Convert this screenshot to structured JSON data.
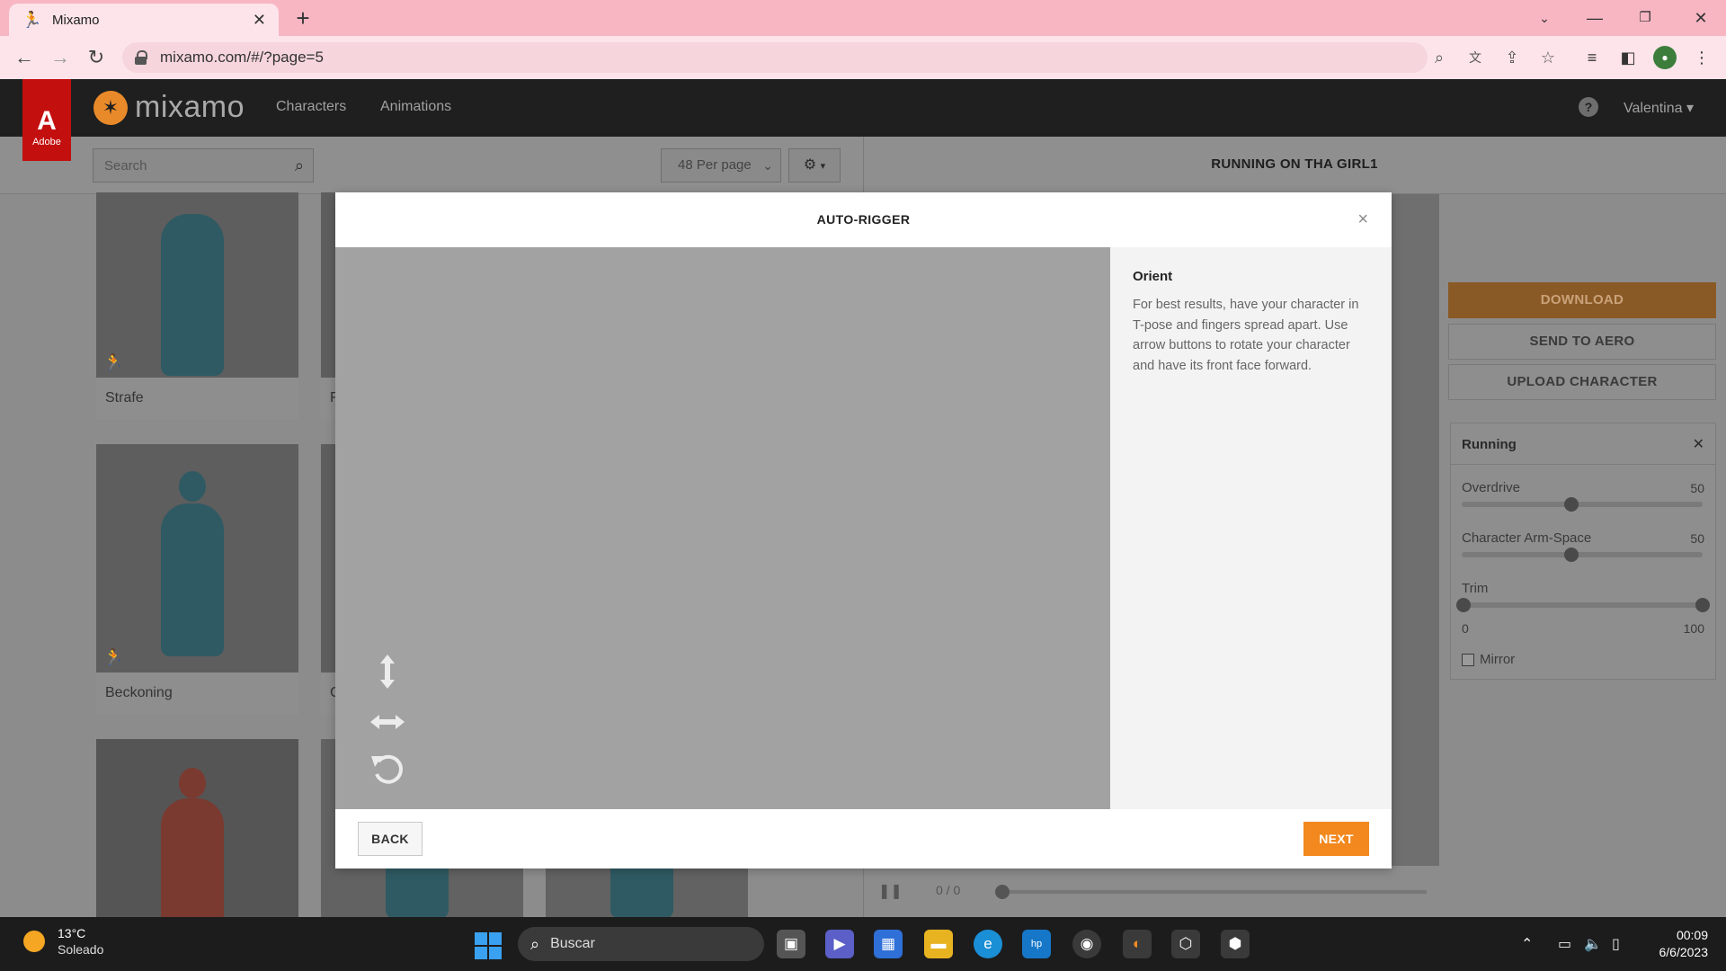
{
  "browser": {
    "tab_title": "Mixamo",
    "url": "mixamo.com/#/?page=5",
    "new_tab_glyph": "+",
    "tab_close_glyph": "✕"
  },
  "app": {
    "adobe_label": "Adobe",
    "logo_text": "mixamo",
    "nav": {
      "characters": "Characters",
      "animations": "Animations"
    },
    "help_glyph": "?",
    "user_name": "Valentina"
  },
  "toolbar": {
    "search_placeholder": "Search",
    "per_page": "48 Per page"
  },
  "grid": {
    "cards": [
      {
        "label": "Strafe"
      },
      {
        "label": "Beckoning"
      },
      {
        "label": ""
      }
    ],
    "cut_labels": [
      "F",
      "C"
    ]
  },
  "viewer": {
    "animation_title": "RUNNING ON THA GIRL1",
    "frame_count": "0 / 0"
  },
  "right_panel": {
    "download": "DOWNLOAD",
    "send_to_aero": "SEND TO AERO",
    "upload_character": "UPLOAD CHARACTER",
    "settings_title": "Running",
    "sliders": [
      {
        "label": "Overdrive",
        "value": "50",
        "fraction": 0.5
      },
      {
        "label": "Character Arm-Space",
        "value": "50",
        "fraction": 0.5
      }
    ],
    "trim": {
      "label": "Trim",
      "min": "0",
      "max": "100"
    },
    "mirror_label": "Mirror"
  },
  "modal": {
    "title": "AUTO-RIGGER",
    "close_glyph": "×",
    "step_title": "Orient",
    "step_text": "For best results, have your character in T-pose and fingers spread apart. Use arrow buttons to rotate your character and have its front face forward.",
    "back": "BACK",
    "next": "NEXT"
  },
  "taskbar": {
    "temperature": "13°C",
    "weather": "Soleado",
    "search": "Buscar",
    "time": "00:09",
    "date": "6/6/2023"
  },
  "colors": {
    "accent": "#f2881e",
    "browser_tab_bar": "#f8b6c3",
    "adobe_red": "#c40f0f"
  },
  "icons": [
    "mixamo-favicon",
    "back-arrow-icon",
    "forward-arrow-icon",
    "reload-icon",
    "lock-icon",
    "zoom-icon",
    "translate-icon",
    "share-icon",
    "star-icon",
    "search-icon",
    "gear-icon",
    "vertical-arrows-icon",
    "horizontal-arrows-icon",
    "rotate-icon",
    "close-icon",
    "running-figure-icon",
    "pause-icon",
    "windows-start-icon"
  ]
}
